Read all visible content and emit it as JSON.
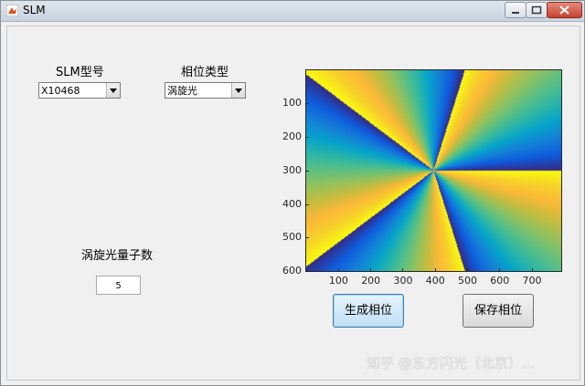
{
  "window": {
    "title": "SLM",
    "controls": {
      "minimize": "minimize",
      "maximize": "maximize",
      "close": "close"
    }
  },
  "panel": {
    "slm_model_label": "SLM型号",
    "slm_model_value": "X10468",
    "phase_type_label": "相位类型",
    "phase_type_value": "涡旋光",
    "vortex_charge_label": "涡旋光量子数",
    "vortex_charge_value": "5"
  },
  "buttons": {
    "generate": "生成相位",
    "save": "保存相位"
  },
  "plot": {
    "type": "image",
    "x_ticks": [
      "100",
      "200",
      "300",
      "400",
      "500",
      "600",
      "700"
    ],
    "y_ticks": [
      "100",
      "200",
      "300",
      "400",
      "500",
      "600"
    ],
    "x_range": [
      1,
      792
    ],
    "y_range": [
      1,
      600
    ],
    "center": [
      396,
      300
    ],
    "topological_charge": 5,
    "colormap": "parula",
    "y_axis_direction": "reverse"
  },
  "watermark": "知乎 @东方闪光（北京）..."
}
